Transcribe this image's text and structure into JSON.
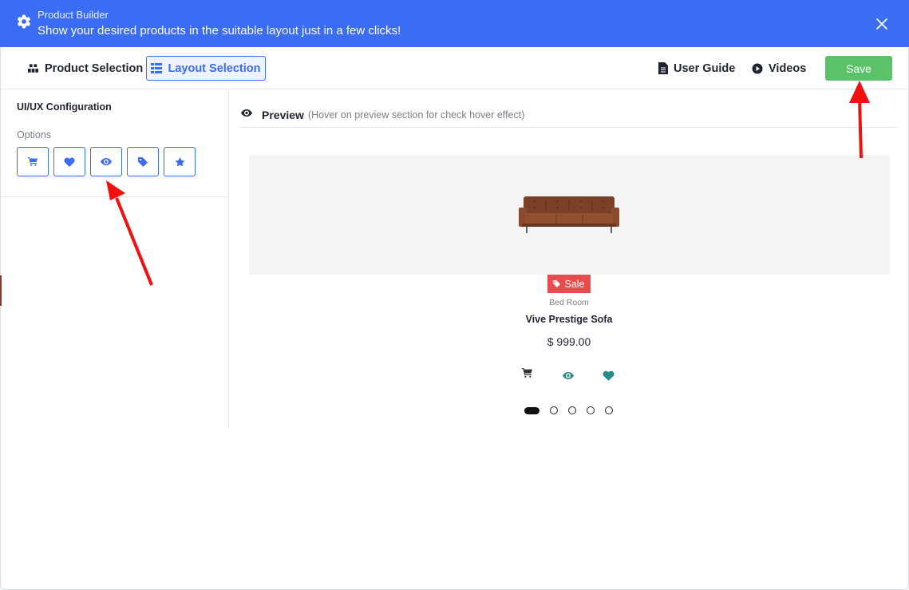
{
  "header": {
    "app_name": "Product Builder",
    "subtitle": "Show your desired products in the suitable layout just in a few clicks!",
    "bg_color": "#3a6cf4"
  },
  "toolbar": {
    "product_selection": "Product Selection",
    "layout_selection": "Layout Selection",
    "user_guide": "User Guide",
    "videos": "Videos",
    "save": "Save",
    "save_color": "#5cc26a"
  },
  "config": {
    "title": "UI/UX Configuration",
    "options_label": "Options",
    "options": [
      {
        "icon": "cart-icon"
      },
      {
        "icon": "heart-icon"
      },
      {
        "icon": "eye-icon"
      },
      {
        "icon": "tag-icon"
      },
      {
        "icon": "star-icon"
      }
    ]
  },
  "preview": {
    "title": "Preview",
    "hint": "(Hover on preview section for check hover effect)",
    "badge": "Sale",
    "badge_color": "#e94c4c",
    "category": "Bed Room",
    "product_name": "Vive Prestige Sofa",
    "price": "$ 999.00",
    "slider": {
      "count": 5,
      "active": 1
    }
  }
}
